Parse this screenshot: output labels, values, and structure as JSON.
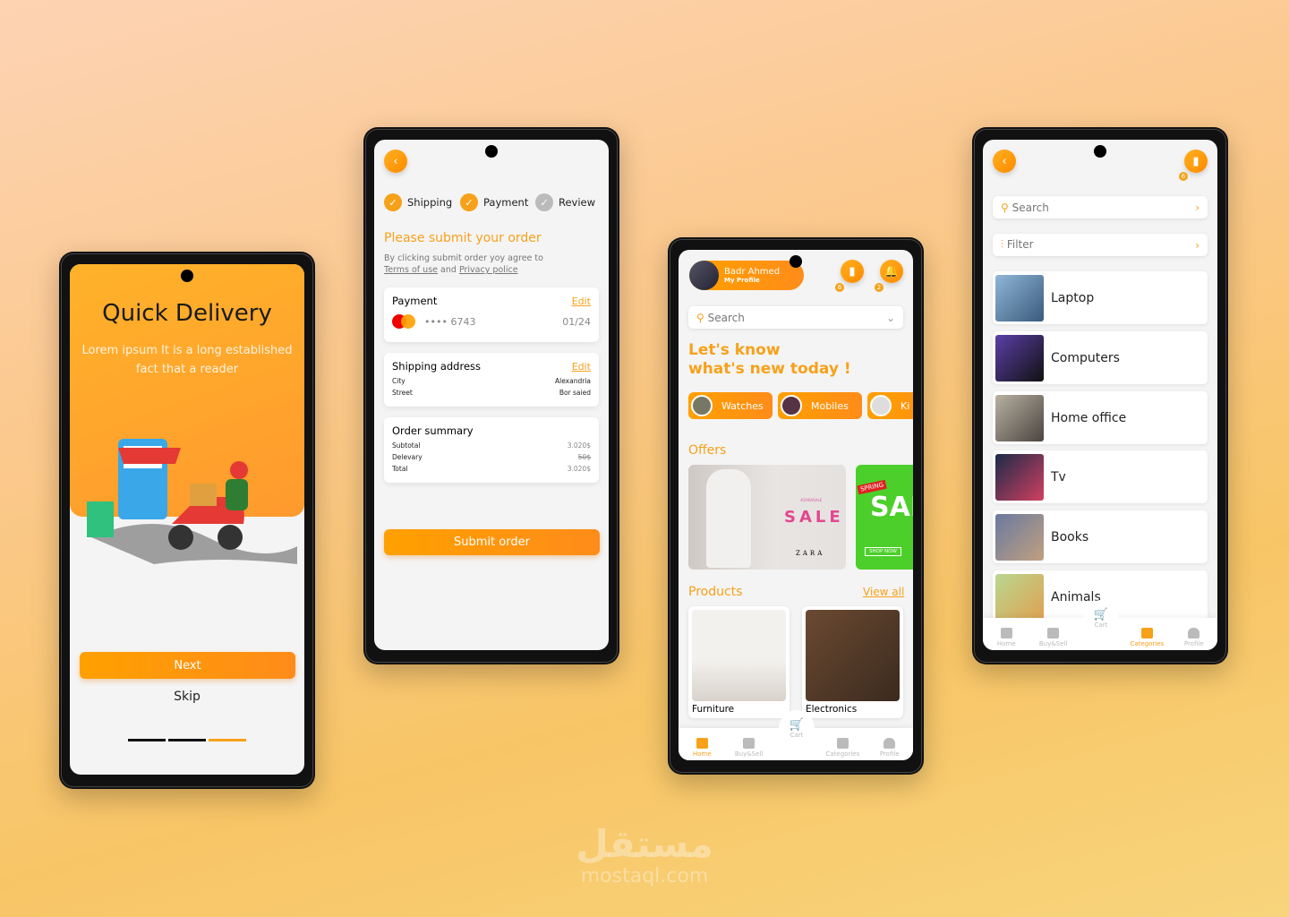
{
  "colors": {
    "accent": "#f7a11a",
    "background": "#f8c97a"
  },
  "onboarding": {
    "title": "Quick Delivery",
    "description": "Lorem ipsum It is a long established fact that a reader",
    "next_label": "Next",
    "skip_label": "Skip",
    "page_index": 3,
    "page_count": 3
  },
  "checkout": {
    "steps": [
      {
        "label": "Shipping",
        "done": true
      },
      {
        "label": "Payment",
        "done": true
      },
      {
        "label": "Review",
        "done": false
      }
    ],
    "title": "Please submit your order",
    "agree_text": "By clicking submit order yoy agree to",
    "terms": "Terms of use",
    "and": "and",
    "privacy": "Privacy police",
    "payment": {
      "title": "Payment",
      "edit": "Edit",
      "card": "•••• 6743",
      "expiry": "01/24"
    },
    "shipping": {
      "title": "Shipping address",
      "edit": "Edit",
      "rows": [
        {
          "label": "City",
          "value": "Alexandria"
        },
        {
          "label": "Street",
          "value": "Bor saied"
        }
      ]
    },
    "summary": {
      "title": "Order summary",
      "rows": [
        {
          "label": "Subtotal",
          "value": "3.020$"
        },
        {
          "label": "Delevary",
          "value": "50$"
        },
        {
          "label": "Total",
          "value": "3.020$"
        }
      ]
    },
    "submit_label": "Submit order"
  },
  "home": {
    "user_name": "Badr Ahmed",
    "profile_label": "My Profile",
    "bookmark_count": "6",
    "notification_count": "2",
    "search_placeholder": "Search",
    "heading_line1": "Let's know",
    "heading_line2": "what's new today !",
    "chips": [
      "Watches",
      "Mobiles",
      "Ki"
    ],
    "offers_label": "Offers",
    "offer1": {
      "small": "#ZARASALE",
      "sale": "SALE",
      "brand": "ZARA"
    },
    "offer2": {
      "tag": "SPRING",
      "sale": "SAL",
      "cta": "SHOP NOW"
    },
    "products_label": "Products",
    "view_all": "View all",
    "products": [
      "Furniture",
      "Electronics"
    ]
  },
  "nav": {
    "home": "Home",
    "buysell": "Buy&Sell",
    "cart": "Cart",
    "categories": "Categories",
    "profile": "Profile"
  },
  "categories": {
    "bookmark_count": "6",
    "search_placeholder": "Search",
    "filter_label": "Filter",
    "items": [
      "Laptop",
      "Computers",
      "Home office",
      "Tv",
      "Books",
      "Animals"
    ]
  },
  "watermark": {
    "arabic": "مستقل",
    "latin": "mostaql.com"
  }
}
